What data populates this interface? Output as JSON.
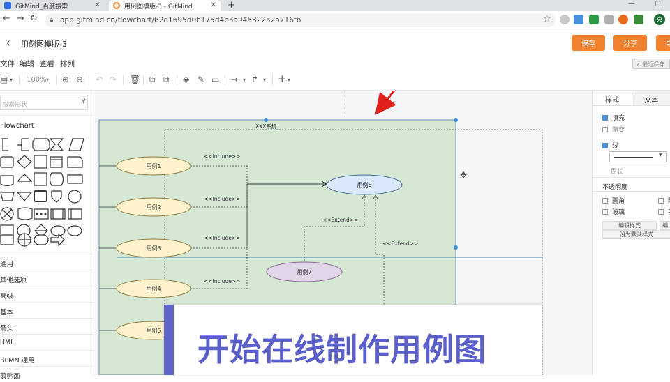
{
  "browser": {
    "tabs": [
      {
        "title": "GitMind_百度搜索",
        "active": false
      },
      {
        "title": "用例图模版-3 - GitMind",
        "active": true
      }
    ],
    "new_tab": "+",
    "url": "app.gitmind.cn/flowchart/62d1695d0b175d4b5a94532252a716fb",
    "profile_initial": "克"
  },
  "app": {
    "back": "‹",
    "document_title": "用例图模版-3",
    "buttons": {
      "save": "保存",
      "share": "分享",
      "more": "导"
    },
    "recent_save": "最近保存"
  },
  "menu": [
    "文件",
    "编辑",
    "查看",
    "排列"
  ],
  "toolbar": {
    "zoom": "100%"
  },
  "left_panel": {
    "search_placeholder": "搜索形状",
    "section": "Flowchart",
    "categories": [
      "通用",
      "其他选项",
      "高级",
      "基本",
      "箭头",
      "UML",
      "BPMN 通用",
      "剪贴画"
    ]
  },
  "diagram": {
    "system_label": "XXX系统",
    "use_cases": [
      "用例1",
      "用例2",
      "用例3",
      "用例4",
      "用例5",
      "用例6",
      "用例7"
    ],
    "include_labels": [
      "<<Include>>",
      "<<Include>>",
      "<<Include>>",
      "<<Include>>"
    ],
    "extend_labels": [
      "<<Extend>>",
      "<<Extend>>"
    ]
  },
  "right_panel": {
    "tabs": [
      "样式",
      "文本"
    ],
    "fill": "填充",
    "gradient": "渐变",
    "line": "线",
    "perimeter": "周长",
    "opacity": "不透明度",
    "rounded": "圆角",
    "glass": "玻璃",
    "shadow": "阴",
    "sketch": "手",
    "edit_style": "编辑样式",
    "edit_more": "编",
    "set_default": "设为默认样式"
  },
  "banner": {
    "text": "开始在线制作用例图"
  },
  "colors": {
    "orange": "#f0812e",
    "container": "#d5e8d4",
    "use_case": "#fff2cc",
    "use_case_blue": "#dae8fc",
    "use_case_pink": "#e1d5e7",
    "banner_purple": "#5b5fc9",
    "arrow_red": "#e0201b"
  }
}
